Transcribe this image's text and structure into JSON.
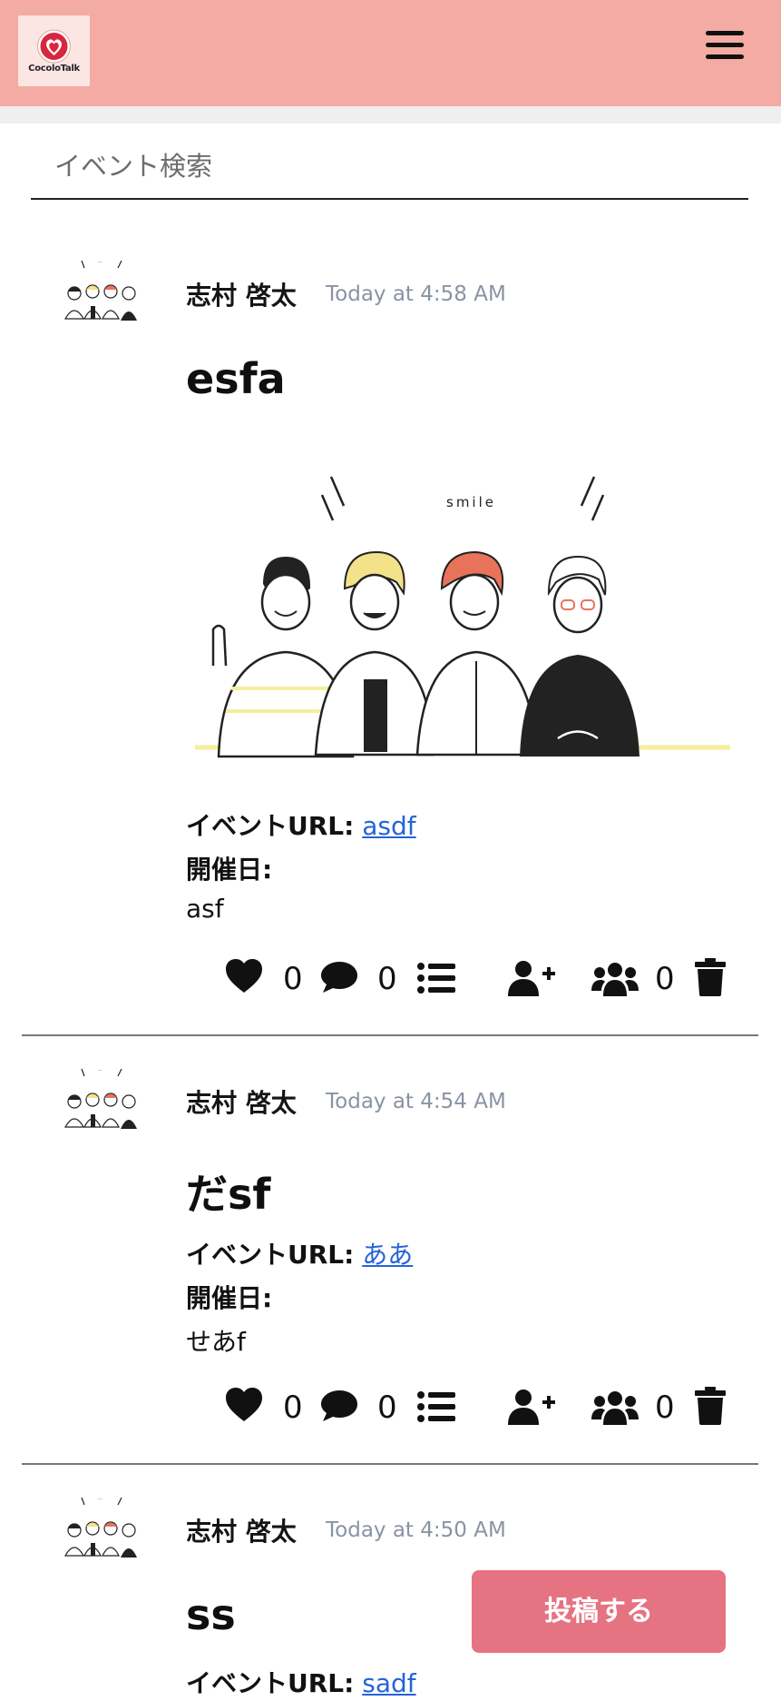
{
  "app": {
    "logo_text": "CocoloTalk"
  },
  "search": {
    "placeholder": "イベント検索"
  },
  "posts": [
    {
      "author": "志村 啓太",
      "time": "Today at 4:58 AM",
      "title": "esfa",
      "image_text": "smile",
      "url_label": "イベントURL:",
      "url_text": "asdf",
      "date_label": "開催日:",
      "description": "asf",
      "likes": "0",
      "comments": "0",
      "participants": "0"
    },
    {
      "author": "志村 啓太",
      "time": "Today at 4:54 AM",
      "title": "だsf",
      "url_label": "イベントURL:",
      "url_text": "ああ",
      "date_label": "開催日:",
      "description": "せあf",
      "likes": "0",
      "comments": "0",
      "participants": "0"
    },
    {
      "author": "志村 啓太",
      "time": "Today at 4:50 AM",
      "title": "ss",
      "url_label": "イベントURL:",
      "url_text": "sadf"
    }
  ],
  "fab": {
    "label": "投稿する"
  },
  "colors": {
    "header": "#f4aba3",
    "fab": "#e57382",
    "link": "#2563d9"
  }
}
